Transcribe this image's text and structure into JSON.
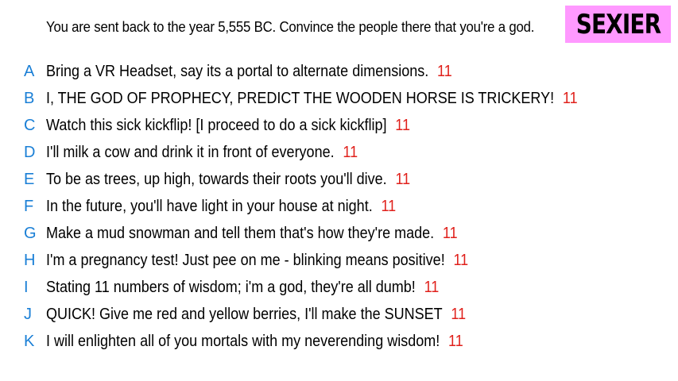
{
  "prompt": "You are sent back to the year 5,555 BC. Convince the people there that you're a god.",
  "badge": {
    "label": "SEXIER",
    "color": "#ff99ff"
  },
  "colors": {
    "letter": "#1a7fd6",
    "score": "#e0201b",
    "text": "#000000"
  },
  "answers": [
    {
      "letter": "A",
      "text": "Bring a VR Headset, say its a portal to alternate dimensions.",
      "score": "11"
    },
    {
      "letter": "B",
      "text": "I, THE GOD OF PROPHECY, PREDICT THE WOODEN HORSE IS TRICKERY!",
      "score": "11"
    },
    {
      "letter": "C",
      "text": "Watch this sick kickflip! [I proceed to do a sick kickflip]",
      "score": "11"
    },
    {
      "letter": "D",
      "text": "I'll milk a cow and drink it in front of everyone.",
      "score": "11"
    },
    {
      "letter": "E",
      "text": "To be as trees, up high, towards their roots you'll dive.",
      "score": "11"
    },
    {
      "letter": "F",
      "text": "In the future, you'll have light in your house at night.",
      "score": "11"
    },
    {
      "letter": "G",
      "text": "Make a mud snowman and tell them that's how they're made.",
      "score": "11"
    },
    {
      "letter": "H",
      "text": "I'm a pregnancy test! Just pee on me - blinking means positive!",
      "score": "11"
    },
    {
      "letter": "I",
      "text": "Stating 11 numbers of wisdom; i'm a god, they're all dumb!",
      "score": "11"
    },
    {
      "letter": "J",
      "text": "QUICK! Give me red and yellow berries, I'll make the SUNSET",
      "score": "11"
    },
    {
      "letter": "K",
      "text": "I will enlighten all of you mortals with my neverending wisdom!",
      "score": "11"
    }
  ]
}
